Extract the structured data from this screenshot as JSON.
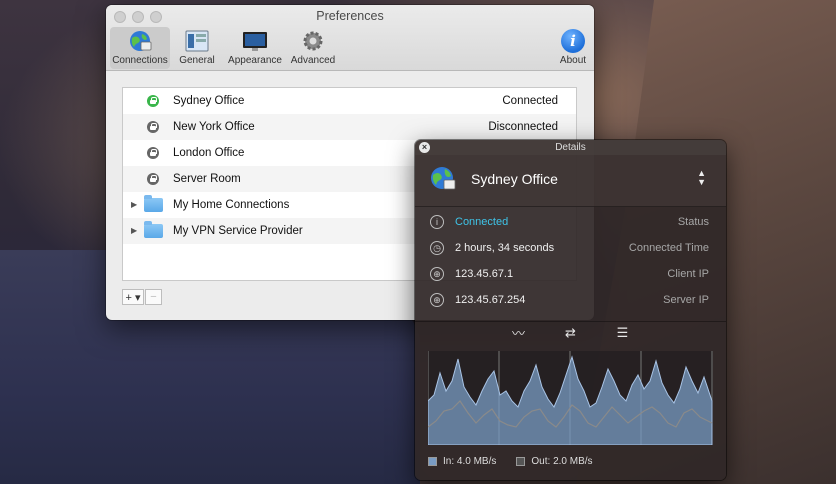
{
  "prefs": {
    "title": "Preferences",
    "toolbar": [
      {
        "label": "Connections",
        "icon": "globe-icon"
      },
      {
        "label": "General",
        "icon": "general-icon"
      },
      {
        "label": "Appearance",
        "icon": "monitor-icon"
      },
      {
        "label": "Advanced",
        "icon": "gear-icon"
      }
    ],
    "about_label": "About",
    "connections": [
      {
        "name": "Sydney Office",
        "status": "Connected",
        "kind": "vpn",
        "connected": true
      },
      {
        "name": "New York Office",
        "status": "Disconnected",
        "kind": "vpn",
        "connected": false
      },
      {
        "name": "London Office",
        "status": "",
        "kind": "vpn",
        "connected": false
      },
      {
        "name": "Server Room",
        "status": "",
        "kind": "vpn",
        "connected": false
      },
      {
        "name": "My Home Connections",
        "status": "",
        "kind": "folder"
      },
      {
        "name": "My VPN Service Provider",
        "status": "",
        "kind": "folder"
      }
    ],
    "add_label": "+ ▾",
    "remove_label": "−"
  },
  "details": {
    "title": "Details",
    "connection_name": "Sydney Office",
    "rows": [
      {
        "value": "Connected",
        "label": "Status",
        "icon": "info-icon"
      },
      {
        "value": "2 hours, 34 seconds",
        "label": "Connected Time",
        "icon": "clock-icon"
      },
      {
        "value": "123.45.67.1",
        "label": "Client IP",
        "icon": "globe-icon"
      },
      {
        "value": "123.45.67.254",
        "label": "Server IP",
        "icon": "globe-icon"
      }
    ],
    "legend": {
      "in_label": "In:",
      "in_value": "4.0 MB/s",
      "out_label": "Out:",
      "out_value": "2.0 MB/s"
    },
    "colors": {
      "status_connected": "#3fc4e8",
      "in_series": "#7a9cc4"
    }
  }
}
